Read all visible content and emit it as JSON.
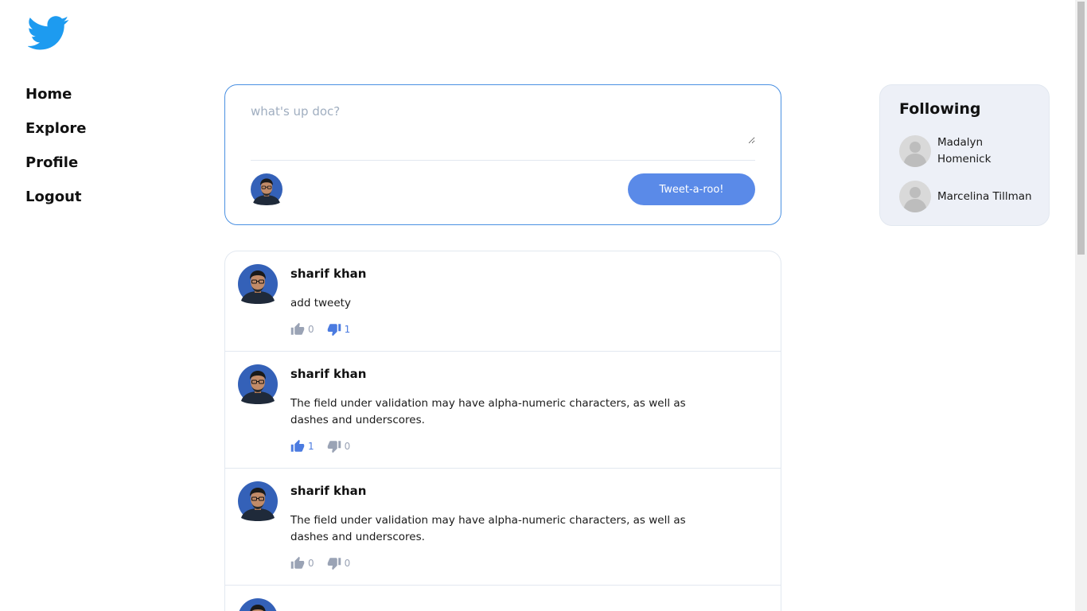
{
  "nav": {
    "logo_icon": "twitter-bird-icon",
    "items": [
      {
        "label": "Home"
      },
      {
        "label": "Explore"
      },
      {
        "label": "Profile"
      },
      {
        "label": "Logout"
      }
    ]
  },
  "composer": {
    "placeholder": "what's up doc?",
    "submit_label": "Tweet-a-roo!"
  },
  "feed": {
    "tweets": [
      {
        "author": "sharif khan",
        "text": "add tweety",
        "likes": "0",
        "dislikes": "1",
        "liked": false,
        "disliked": true
      },
      {
        "author": "sharif khan",
        "text": "The field under validation may have alpha-numeric characters, as well as dashes and underscores.",
        "likes": "1",
        "dislikes": "0",
        "liked": true,
        "disliked": false
      },
      {
        "author": "sharif khan",
        "text": "The field under validation may have alpha-numeric characters, as well as dashes and underscores.",
        "likes": "0",
        "dislikes": "0",
        "liked": false,
        "disliked": false
      },
      {
        "author": "",
        "text": "",
        "likes": "",
        "dislikes": "",
        "liked": false,
        "disliked": false
      }
    ]
  },
  "following": {
    "title": "Following",
    "users": [
      {
        "name": "Madalyn Homenick"
      },
      {
        "name": "Marcelina Tillman"
      }
    ]
  },
  "colors": {
    "brand_blue": "#1d9bf0",
    "button_blue": "#5a8ae8",
    "active_blue": "#4b7be0",
    "inactive_gray": "#9aa3b5",
    "panel_bg": "#edf0f7"
  }
}
